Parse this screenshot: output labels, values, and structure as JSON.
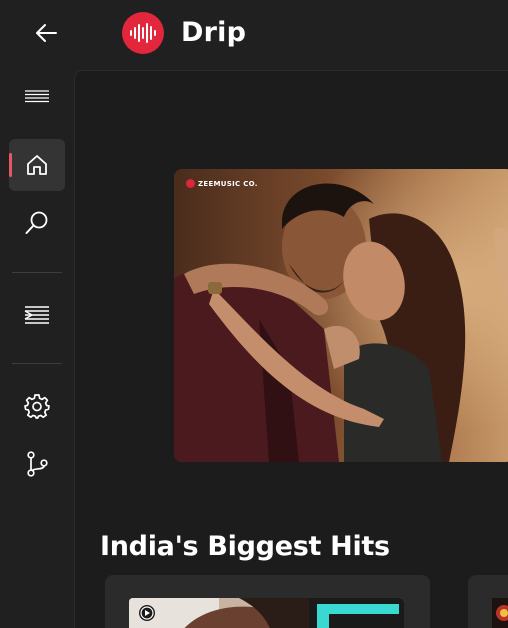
{
  "app": {
    "title": "Drip",
    "accent_color": "#e2263c"
  },
  "titlebar": {
    "back_icon": "arrow-left-icon"
  },
  "sidebar": {
    "items": [
      {
        "name": "menu",
        "icon": "hamburger-menu-icon",
        "selected": false
      },
      {
        "name": "home",
        "icon": "home-icon",
        "selected": true
      },
      {
        "name": "search",
        "icon": "search-icon",
        "selected": false
      },
      {
        "name": "library",
        "icon": "playlist-icon",
        "selected": false
      },
      {
        "name": "settings",
        "icon": "gear-icon",
        "selected": false
      },
      {
        "name": "source",
        "icon": "git-branch-icon",
        "selected": false
      }
    ]
  },
  "main": {
    "hero": {
      "label": "ZEEMUSIC CO."
    },
    "sections": [
      {
        "heading": "India's Biggest Hits"
      }
    ]
  }
}
